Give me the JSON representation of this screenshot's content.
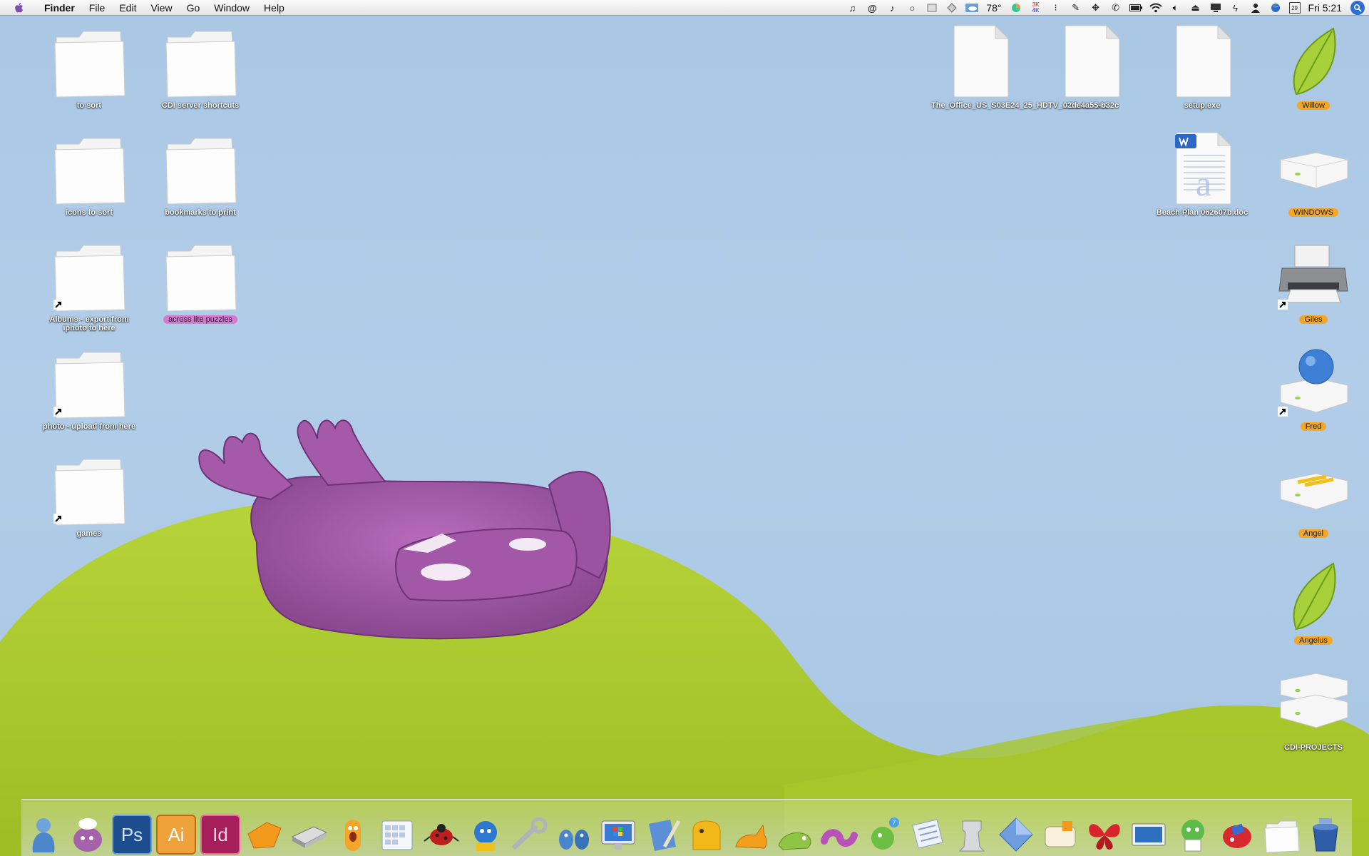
{
  "menubar": {
    "apple_icon": "apple-logo-icon",
    "app_name": "Finder",
    "menus": [
      "File",
      "Edit",
      "View",
      "Go",
      "Window",
      "Help"
    ],
    "extras_left": [
      "music-note-icon",
      "at-sign-icon",
      "eighth-note-icon",
      "circle-icon",
      "disk-icon",
      "network-icon",
      "weather-icon"
    ],
    "temperature": "78°",
    "extras_right": [
      "pie-chart-icon",
      "netspeed-icon",
      "volume-dots-icon",
      "pencil-icon",
      "move-icon",
      "phone-icon",
      "battery-icon",
      "wifi-icon",
      "speaker-icon",
      "eject-icon",
      "display-icon",
      "bolt-icon",
      "user-icon",
      "globe-icon",
      "calendar-icon"
    ],
    "netspeed": [
      "3K",
      "4K"
    ],
    "calendar_day": "29",
    "clock": "Fri 5:21",
    "spotlight_icon": "spotlight-icon"
  },
  "desktop_icons_left": [
    {
      "label": "to sort",
      "type": "folder",
      "alias": false,
      "tag": ""
    },
    {
      "label": "CDI server shortcuts",
      "type": "folder",
      "alias": false,
      "tag": ""
    },
    {
      "label": "icons to sort",
      "type": "folder",
      "alias": false,
      "tag": ""
    },
    {
      "label": "bookmarks to print",
      "type": "folder",
      "alias": false,
      "tag": ""
    },
    {
      "label": "Albums - export from iphoto to here",
      "type": "folder",
      "alias": true,
      "tag": ""
    },
    {
      "label": "across lite puzzles",
      "type": "folder",
      "alias": false,
      "tag": "#d27ad0"
    },
    {
      "label": "photo - upload from here",
      "type": "folder",
      "alias": true,
      "tag": ""
    },
    {
      "label": "games",
      "type": "folder",
      "alias": true,
      "tag": ""
    }
  ],
  "desktop_icons_right": [
    {
      "label": "The_Office_US_S03E24_25_HDTV_...OL.torrent",
      "type": "file"
    },
    {
      "label": "02de4a55-b32c",
      "type": "file"
    },
    {
      "label": "setup.exe",
      "type": "file"
    },
    {
      "label": "Beach Plan 062607b.doc",
      "type": "word-doc"
    }
  ],
  "volumes": [
    {
      "label": "Willow",
      "type": "leaf",
      "tag": "#f5a623",
      "alias": false
    },
    {
      "label": "WINDOWS",
      "type": "drive",
      "tag": "#f5a623",
      "alias": false
    },
    {
      "label": "Giles",
      "type": "printer",
      "tag": "#f5a623",
      "alias": true
    },
    {
      "label": "Fred",
      "type": "globe-drive",
      "tag": "#f5a623",
      "alias": true
    },
    {
      "label": "Angel",
      "type": "drive-yellow",
      "tag": "#f5a623",
      "alias": false
    },
    {
      "label": "Angelus",
      "type": "leaf",
      "tag": "#f5a623",
      "alias": false
    },
    {
      "label": "CDI-PROJECTS",
      "type": "drive-stack",
      "tag": "",
      "alias": false
    }
  ],
  "dock": [
    {
      "icon": "finder-guy-icon",
      "running": true
    },
    {
      "icon": "chef-monster-icon",
      "running": false
    },
    {
      "icon": "photoshop-icon",
      "text": "Ps",
      "running": false
    },
    {
      "icon": "illustrator-icon",
      "text": "Ai",
      "running": false
    },
    {
      "icon": "indesign-icon",
      "text": "Id",
      "running": false
    },
    {
      "icon": "orange-tag-icon",
      "running": false
    },
    {
      "icon": "scanner-icon",
      "running": false
    },
    {
      "icon": "orange-monster-icon",
      "running": false
    },
    {
      "icon": "calendar-grid-icon",
      "running": false
    },
    {
      "icon": "ladybug-icon",
      "running": false
    },
    {
      "icon": "mail-bird-icon",
      "running": false
    },
    {
      "icon": "wrench-icon",
      "running": false
    },
    {
      "icon": "monster-pair-icon",
      "running": false
    },
    {
      "icon": "windows-monitor-icon",
      "running": false
    },
    {
      "icon": "notepad-pencil-icon",
      "running": false
    },
    {
      "icon": "yellow-elephant-icon",
      "running": false
    },
    {
      "icon": "orange-cat-icon",
      "running": false
    },
    {
      "icon": "green-creature-icon",
      "running": true
    },
    {
      "icon": "purple-worm-icon",
      "running": false
    },
    {
      "icon": "green-bird-icon",
      "running": false
    },
    {
      "icon": "newspaper-icon",
      "running": false
    },
    {
      "icon": "rook-icon",
      "running": false
    },
    {
      "icon": "blue-diamond-icon",
      "running": false
    },
    {
      "icon": "mailbox-icon",
      "running": false
    },
    {
      "icon": "butterfly-icon",
      "running": false
    },
    {
      "icon": "blue-screen-icon",
      "running": true
    },
    {
      "icon": "green-robot-icon",
      "running": false
    },
    {
      "icon": "red-bug-icon",
      "running": true
    },
    {
      "icon": "documents-folder-icon",
      "running": false
    },
    {
      "icon": "trash-icon",
      "running": false
    }
  ]
}
